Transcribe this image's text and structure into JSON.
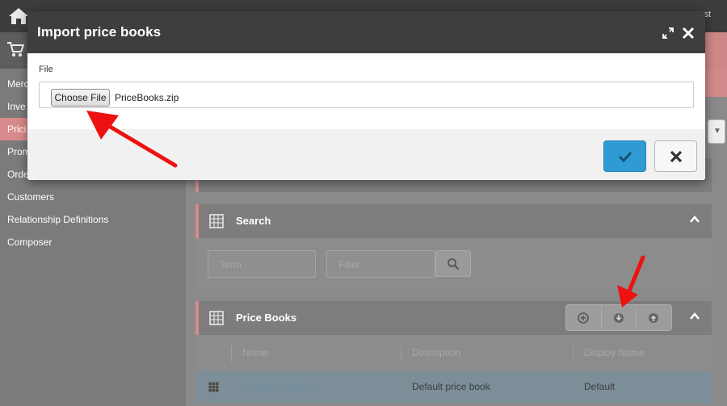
{
  "background": {
    "sidebar_items": [
      {
        "label": "Merc",
        "active": false
      },
      {
        "label": "Inve",
        "active": false
      },
      {
        "label": "Prici",
        "active": true
      },
      {
        "label": "Prom",
        "active": false
      },
      {
        "label": "Orde",
        "active": false
      },
      {
        "label": "Customers",
        "active": false
      },
      {
        "label": "Relationship Definitions",
        "active": false
      },
      {
        "label": "Composer",
        "active": false
      }
    ],
    "search_panel": {
      "title": "Search",
      "term_placeholder": "Term",
      "filter_placeholder": "Filter"
    },
    "price_books_panel": {
      "title": "Price Books",
      "columns": [
        "Name",
        "Description",
        "Display Name"
      ],
      "rows": [
        {
          "name": "DefaultPriceBook",
          "description": "Default price book",
          "display_name": "Default"
        }
      ]
    }
  },
  "modal": {
    "title": "Import price books",
    "field_label": "File",
    "choose_file_label": "Choose File",
    "file_name": "PriceBooks.zip"
  },
  "colors": {
    "accent": "#d98a8a",
    "primary_button": "#2f9bd4",
    "annotation_arrow": "#ee1111"
  },
  "icons": [
    "home-icon",
    "cart-icon",
    "grid-icon",
    "chevron-up-icon",
    "search-icon",
    "add-icon",
    "import-icon",
    "export-icon",
    "expand-icon",
    "close-icon",
    "check-icon",
    "cancel-icon"
  ]
}
